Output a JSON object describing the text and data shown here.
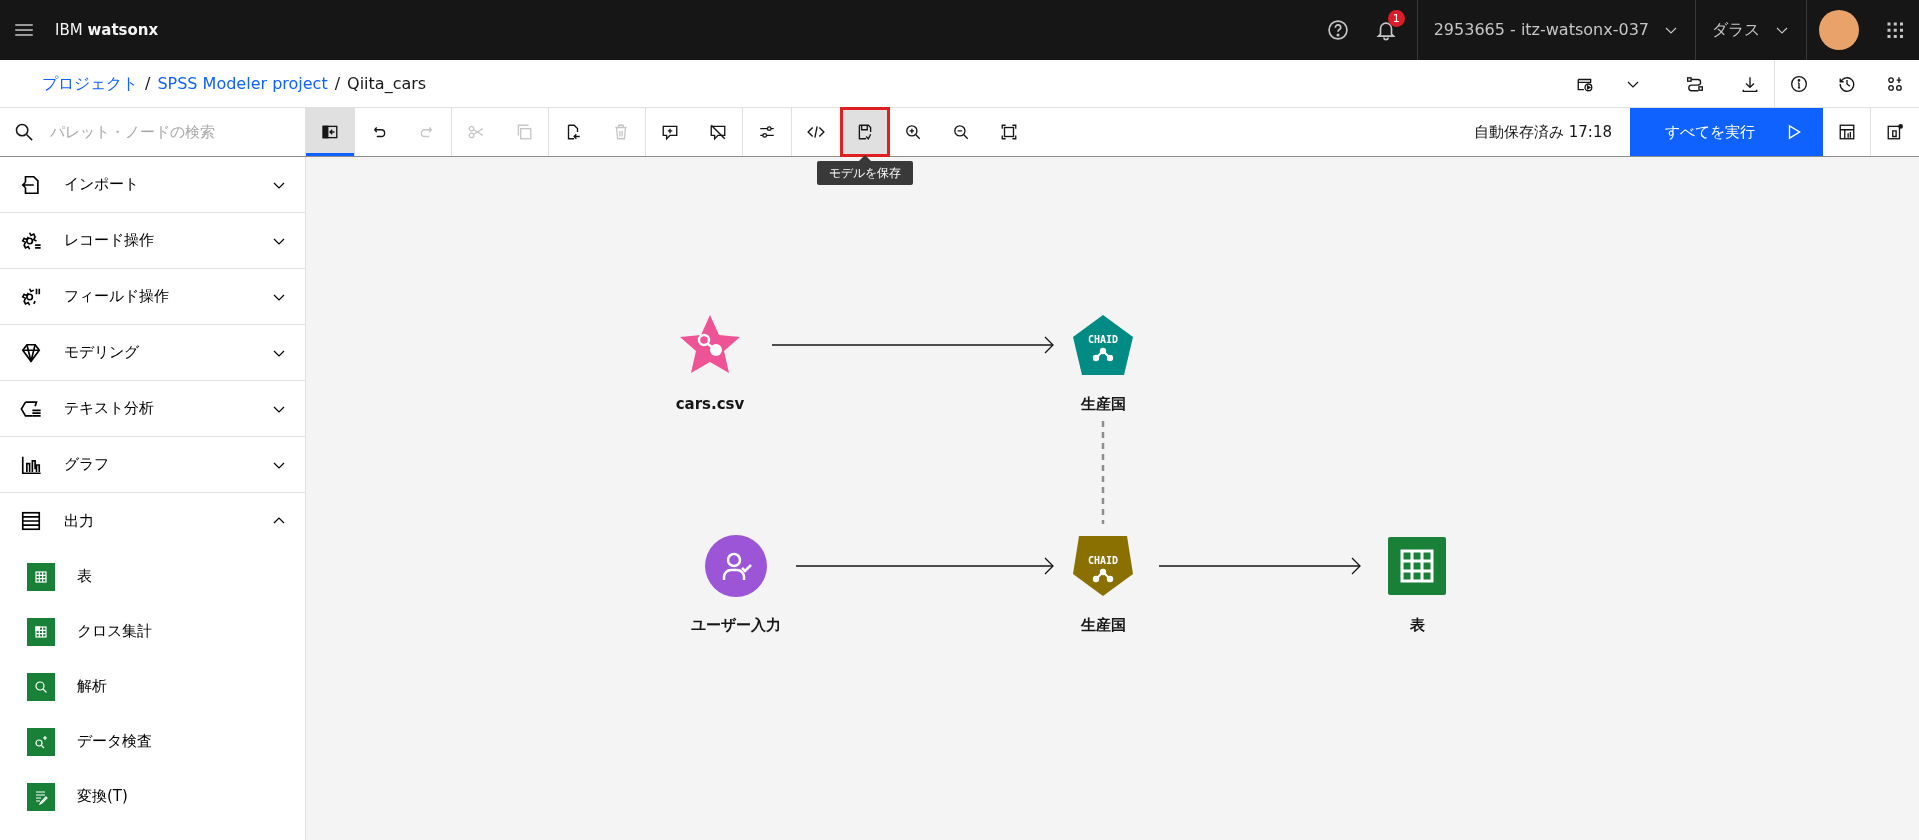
{
  "header": {
    "product": "IBM **watsonx**",
    "notification_count": "1",
    "account": "2953665 - itz-watsonx-037",
    "region": "ダラス"
  },
  "breadcrumb": {
    "items": [
      {
        "label": "プロジェクト",
        "link": true
      },
      {
        "label": "SPSS Modeler project",
        "link": true
      },
      {
        "label": "Qiita_cars",
        "link": false
      }
    ],
    "separators": [
      "/",
      "/"
    ]
  },
  "search": {
    "placeholder": "パレット・ノードの検索"
  },
  "toolbar": {
    "buttons": [
      {
        "selected": true,
        "disabled": false,
        "highlighted": false
      },
      {
        "selected": false,
        "disabled": false,
        "highlighted": false
      },
      {
        "selected": false,
        "disabled": true,
        "highlighted": false
      },
      {
        "selected": false,
        "disabled": true,
        "highlighted": false
      },
      {
        "selected": false,
        "disabled": true,
        "highlighted": false
      },
      {
        "selected": false,
        "disabled": false,
        "highlighted": false
      },
      {
        "selected": false,
        "disabled": true,
        "highlighted": false
      },
      {
        "selected": false,
        "disabled": false,
        "highlighted": false
      },
      {
        "selected": false,
        "disabled": false,
        "highlighted": false
      },
      {
        "selected": false,
        "disabled": false,
        "highlighted": false
      },
      {
        "selected": false,
        "disabled": false,
        "highlighted": false
      },
      {
        "selected": false,
        "disabled": false,
        "highlighted": true
      },
      {
        "selected": false,
        "disabled": false,
        "highlighted": false
      },
      {
        "selected": false,
        "disabled": false,
        "highlighted": false
      },
      {
        "selected": false,
        "disabled": false,
        "highlighted": false
      }
    ],
    "tooltip": "モデルを保存",
    "autosave": "自動保存済み 17:18",
    "run_all": "すべてを実行"
  },
  "palette": [
    {
      "label": "インポート",
      "expanded": false
    },
    {
      "label": "レコード操作",
      "expanded": false
    },
    {
      "label": "フィールド操作",
      "expanded": false
    },
    {
      "label": "モデリング",
      "expanded": false
    },
    {
      "label": "テキスト分析",
      "expanded": false
    },
    {
      "label": "グラフ",
      "expanded": false
    },
    {
      "label": "出力",
      "expanded": true,
      "children": [
        {
          "label": "表"
        },
        {
          "label": "クロス集計"
        },
        {
          "label": "解析"
        },
        {
          "label": "データ検査"
        },
        {
          "label": "変換(T)"
        }
      ]
    }
  ],
  "canvas": {
    "nodes": [
      {
        "kind": "source",
        "label": "cars.csv",
        "color": "#ee5396"
      },
      {
        "kind": "model",
        "label": "生産国",
        "badge": "CHAID",
        "color": "#008b84"
      },
      {
        "kind": "user",
        "label": "ユーザー入力",
        "color": "#9b55d6"
      },
      {
        "kind": "model",
        "label": "生産国",
        "badge": "CHAID",
        "color": "#8a7000"
      },
      {
        "kind": "table",
        "label": "表",
        "color": "#198038"
      }
    ],
    "links": [
      {
        "kind": "arrow"
      },
      {
        "kind": "arrow"
      },
      {
        "kind": "arrow"
      },
      {
        "kind": "dashed"
      }
    ]
  }
}
